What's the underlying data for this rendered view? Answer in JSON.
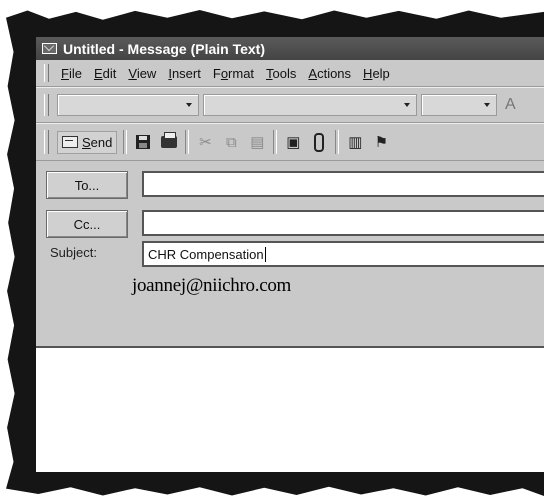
{
  "window": {
    "title": "Untitled - Message (Plain Text)"
  },
  "menubar": {
    "items": [
      {
        "underline": "F",
        "rest": "ile"
      },
      {
        "underline": "E",
        "rest": "dit"
      },
      {
        "underline": "V",
        "rest": "iew"
      },
      {
        "underline": "I",
        "rest": "nsert"
      },
      {
        "pre": "F",
        "underline": "o",
        "rest": "rmat"
      },
      {
        "underline": "T",
        "rest": "ools"
      },
      {
        "underline": "A",
        "rest": "ctions"
      },
      {
        "underline": "H",
        "rest": "elp"
      }
    ]
  },
  "toolbar": {
    "send_label": "Send",
    "send_underline": "S",
    "send_rest": "end",
    "icons": [
      "save-icon",
      "print-icon",
      "cut-icon",
      "copy-icon",
      "paste-icon",
      "check-names-icon",
      "attach-icon",
      "address-book-icon",
      "flag-icon"
    ]
  },
  "headers": {
    "to_button": "To...",
    "cc_button": "Cc...",
    "to_value": "",
    "cc_value": "",
    "subject_label": "Subject:",
    "subject_value": "CHR Compensation"
  },
  "overlay": {
    "email": "joannej@niichro.com"
  }
}
